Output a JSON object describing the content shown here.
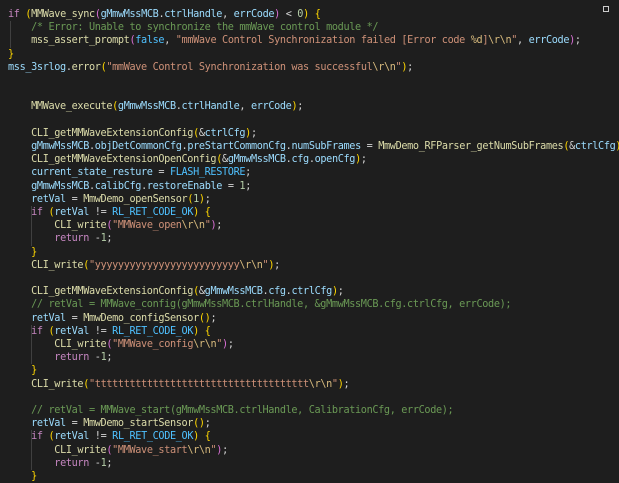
{
  "colors": {
    "background": "#1e1e1e",
    "keyword": "#c586c0",
    "function": "#dcdcaa",
    "variable": "#9cdcfe",
    "string": "#ce9178",
    "number": "#b5cea8",
    "comment": "#6a9955",
    "constant": "#4fc1ff",
    "plain": "#d4d4d4"
  },
  "lines": [
    [
      [
        "kw",
        "if"
      ],
      [
        "pl",
        " "
      ],
      [
        "br1",
        "("
      ],
      [
        "fn",
        "MMWave_sync"
      ],
      [
        "br2",
        "("
      ],
      [
        "var",
        "gMmwMssMCB"
      ],
      [
        "pl",
        "."
      ],
      [
        "var",
        "ctrlHandle"
      ],
      [
        "pl",
        ", "
      ],
      [
        "var",
        "errCode"
      ],
      [
        "br2",
        ")"
      ],
      [
        "pl",
        " < "
      ],
      [
        "num",
        "0"
      ],
      [
        "br1",
        ")"
      ],
      [
        "pl",
        " "
      ],
      [
        "br1",
        "{"
      ]
    ],
    [
      [
        "pl",
        "    "
      ],
      [
        "cm",
        "/* Error: Unable to synchronize the mmWave control module */"
      ]
    ],
    [
      [
        "pl",
        "    "
      ],
      [
        "fn",
        "mss_assert_prompt"
      ],
      [
        "br2",
        "("
      ],
      [
        "const",
        "false"
      ],
      [
        "pl",
        ", "
      ],
      [
        "str",
        "\"mmWave Control Synchronization failed [Error code "
      ],
      [
        "esc",
        "%d"
      ],
      [
        "str",
        "]"
      ],
      [
        "esc",
        "\\r\\n"
      ],
      [
        "str",
        "\""
      ],
      [
        "pl",
        ", "
      ],
      [
        "var",
        "errCode"
      ],
      [
        "br2",
        ")"
      ],
      [
        "pl",
        ";"
      ]
    ],
    [
      [
        "br1",
        "}"
      ]
    ],
    [
      [
        "var",
        "mss_3srlog"
      ],
      [
        "pl",
        "."
      ],
      [
        "fn",
        "error"
      ],
      [
        "br1",
        "("
      ],
      [
        "str",
        "\"mmWave Control Synchronization was successful"
      ],
      [
        "esc",
        "\\r\\n"
      ],
      [
        "str",
        "\""
      ],
      [
        "br1",
        ")"
      ],
      [
        "pl",
        ";"
      ]
    ],
    [],
    [],
    [
      [
        "pl",
        "    "
      ],
      [
        "fn",
        "MMWave_execute"
      ],
      [
        "br1",
        "("
      ],
      [
        "var",
        "gMmwMssMCB"
      ],
      [
        "pl",
        "."
      ],
      [
        "var",
        "ctrlHandle"
      ],
      [
        "pl",
        ", "
      ],
      [
        "var",
        "errCode"
      ],
      [
        "br1",
        ")"
      ],
      [
        "pl",
        ";"
      ]
    ],
    [],
    [
      [
        "pl",
        "    "
      ],
      [
        "fn",
        "CLI_getMMWaveExtensionConfig"
      ],
      [
        "br1",
        "("
      ],
      [
        "pl",
        "&"
      ],
      [
        "var",
        "ctrlCfg"
      ],
      [
        "br1",
        ")"
      ],
      [
        "pl",
        ";"
      ]
    ],
    [
      [
        "pl",
        "    "
      ],
      [
        "var",
        "gMmwMssMCB"
      ],
      [
        "pl",
        "."
      ],
      [
        "var",
        "objDetCommonCfg"
      ],
      [
        "pl",
        "."
      ],
      [
        "var",
        "preStartCommonCfg"
      ],
      [
        "pl",
        "."
      ],
      [
        "var",
        "numSubFrames"
      ],
      [
        "pl",
        " = "
      ],
      [
        "fn",
        "MmwDemo_RFParser_getNumSubFrames"
      ],
      [
        "br1",
        "("
      ],
      [
        "pl",
        "&"
      ],
      [
        "var",
        "ctrlCfg"
      ],
      [
        "br1",
        ")"
      ],
      [
        "pl",
        ";"
      ]
    ],
    [
      [
        "pl",
        "    "
      ],
      [
        "fn",
        "CLI_getMMWaveExtensionOpenConfig"
      ],
      [
        "br1",
        "("
      ],
      [
        "pl",
        "&"
      ],
      [
        "var",
        "gMmwMssMCB"
      ],
      [
        "pl",
        "."
      ],
      [
        "var",
        "cfg"
      ],
      [
        "pl",
        "."
      ],
      [
        "var",
        "openCfg"
      ],
      [
        "br1",
        ")"
      ],
      [
        "pl",
        ";"
      ]
    ],
    [
      [
        "pl",
        "    "
      ],
      [
        "var",
        "current_state_resture"
      ],
      [
        "pl",
        " = "
      ],
      [
        "const",
        "FLASH_RESTORE"
      ],
      [
        "pl",
        ";"
      ]
    ],
    [
      [
        "pl",
        "    "
      ],
      [
        "var",
        "gMmwMssMCB"
      ],
      [
        "pl",
        "."
      ],
      [
        "var",
        "calibCfg"
      ],
      [
        "pl",
        "."
      ],
      [
        "var",
        "restoreEnable"
      ],
      [
        "pl",
        " = "
      ],
      [
        "num",
        "1"
      ],
      [
        "pl",
        ";"
      ]
    ],
    [
      [
        "pl",
        "    "
      ],
      [
        "var",
        "retVal"
      ],
      [
        "pl",
        " = "
      ],
      [
        "fn",
        "MmwDemo_openSensor"
      ],
      [
        "br1",
        "("
      ],
      [
        "num",
        "1"
      ],
      [
        "br1",
        ")"
      ],
      [
        "pl",
        ";"
      ]
    ],
    [
      [
        "pl",
        "    "
      ],
      [
        "kw",
        "if"
      ],
      [
        "pl",
        " "
      ],
      [
        "br1",
        "("
      ],
      [
        "var",
        "retVal"
      ],
      [
        "pl",
        " != "
      ],
      [
        "const",
        "RL_RET_CODE_OK"
      ],
      [
        "br1",
        ")"
      ],
      [
        "pl",
        " "
      ],
      [
        "br1",
        "{"
      ]
    ],
    [
      [
        "pl",
        "        "
      ],
      [
        "fn",
        "CLI_write"
      ],
      [
        "br2",
        "("
      ],
      [
        "str",
        "\"MMWave_open"
      ],
      [
        "esc",
        "\\r\\n"
      ],
      [
        "str",
        "\""
      ],
      [
        "br2",
        ")"
      ],
      [
        "pl",
        ";"
      ]
    ],
    [
      [
        "pl",
        "        "
      ],
      [
        "kw",
        "return"
      ],
      [
        "pl",
        " -"
      ],
      [
        "num",
        "1"
      ],
      [
        "pl",
        ";"
      ]
    ],
    [
      [
        "pl",
        "    "
      ],
      [
        "br1",
        "}"
      ]
    ],
    [
      [
        "pl",
        "    "
      ],
      [
        "fn",
        "CLI_write"
      ],
      [
        "br1",
        "("
      ],
      [
        "str",
        "\"yyyyyyyyyyyyyyyyyyyyyyyyy"
      ],
      [
        "esc",
        "\\r\\n"
      ],
      [
        "str",
        "\""
      ],
      [
        "br1",
        ")"
      ],
      [
        "pl",
        ";"
      ]
    ],
    [],
    [
      [
        "pl",
        "    "
      ],
      [
        "fn",
        "CLI_getMMWaveExtensionConfig"
      ],
      [
        "br1",
        "("
      ],
      [
        "pl",
        "&"
      ],
      [
        "var",
        "gMmwMssMCB"
      ],
      [
        "pl",
        "."
      ],
      [
        "var",
        "cfg"
      ],
      [
        "pl",
        "."
      ],
      [
        "var",
        "ctrlCfg"
      ],
      [
        "br1",
        ")"
      ],
      [
        "pl",
        ";"
      ]
    ],
    [
      [
        "pl",
        "    "
      ],
      [
        "cm",
        "// retVal = MMWave_config(gMmwMssMCB.ctrlHandle, &gMmwMssMCB.cfg.ctrlCfg, errCode);"
      ]
    ],
    [
      [
        "pl",
        "    "
      ],
      [
        "var",
        "retVal"
      ],
      [
        "pl",
        " = "
      ],
      [
        "fn",
        "MmwDemo_configSensor"
      ],
      [
        "br1",
        "("
      ],
      [
        "br1",
        ")"
      ],
      [
        "pl",
        ";"
      ]
    ],
    [
      [
        "pl",
        "    "
      ],
      [
        "kw",
        "if"
      ],
      [
        "pl",
        " "
      ],
      [
        "br1",
        "("
      ],
      [
        "var",
        "retVal"
      ],
      [
        "pl",
        " != "
      ],
      [
        "const",
        "RL_RET_CODE_OK"
      ],
      [
        "br1",
        ")"
      ],
      [
        "pl",
        " "
      ],
      [
        "br1",
        "{"
      ]
    ],
    [
      [
        "pl",
        "        "
      ],
      [
        "fn",
        "CLI_write"
      ],
      [
        "br2",
        "("
      ],
      [
        "str",
        "\"MMWave_config"
      ],
      [
        "esc",
        "\\r\\n"
      ],
      [
        "str",
        "\""
      ],
      [
        "br2",
        ")"
      ],
      [
        "pl",
        ";"
      ]
    ],
    [
      [
        "pl",
        "        "
      ],
      [
        "kw",
        "return"
      ],
      [
        "pl",
        " -"
      ],
      [
        "num",
        "1"
      ],
      [
        "pl",
        ";"
      ]
    ],
    [
      [
        "pl",
        "    "
      ],
      [
        "br1",
        "}"
      ]
    ],
    [
      [
        "pl",
        "    "
      ],
      [
        "fn",
        "CLI_write"
      ],
      [
        "br1",
        "("
      ],
      [
        "str",
        "\"ttttttttttttttttttttttttttttttttttttt"
      ],
      [
        "esc",
        "\\r\\n"
      ],
      [
        "str",
        "\""
      ],
      [
        "br1",
        ")"
      ],
      [
        "pl",
        ";"
      ]
    ],
    [],
    [
      [
        "pl",
        "    "
      ],
      [
        "cm",
        "// retVal = MMWave_start(gMmwMssMCB.ctrlHandle, CalibrationCfg, errCode);"
      ]
    ],
    [
      [
        "pl",
        "    "
      ],
      [
        "var",
        "retVal"
      ],
      [
        "pl",
        " = "
      ],
      [
        "fn",
        "MmwDemo_startSensor"
      ],
      [
        "br1",
        "("
      ],
      [
        "br1",
        ")"
      ],
      [
        "pl",
        ";"
      ]
    ],
    [
      [
        "pl",
        "    "
      ],
      [
        "kw",
        "if"
      ],
      [
        "pl",
        " "
      ],
      [
        "br1",
        "("
      ],
      [
        "var",
        "retVal"
      ],
      [
        "pl",
        " != "
      ],
      [
        "const",
        "RL_RET_CODE_OK"
      ],
      [
        "br1",
        ")"
      ],
      [
        "pl",
        " "
      ],
      [
        "br1",
        "{"
      ]
    ],
    [
      [
        "pl",
        "        "
      ],
      [
        "fn",
        "CLI_write"
      ],
      [
        "br2",
        "("
      ],
      [
        "str",
        "\"MMWave_start"
      ],
      [
        "esc",
        "\\r\\n"
      ],
      [
        "str",
        "\""
      ],
      [
        "br2",
        ")"
      ],
      [
        "pl",
        ";"
      ]
    ],
    [
      [
        "pl",
        "        "
      ],
      [
        "kw",
        "return"
      ],
      [
        "pl",
        " -"
      ],
      [
        "num",
        "1"
      ],
      [
        "pl",
        ";"
      ]
    ],
    [
      [
        "pl",
        "    "
      ],
      [
        "br1",
        "}"
      ]
    ]
  ]
}
